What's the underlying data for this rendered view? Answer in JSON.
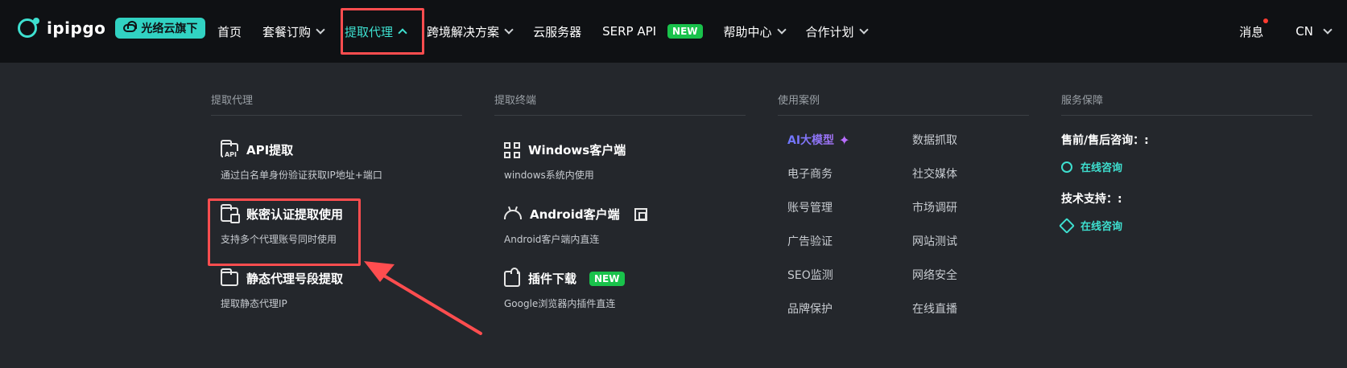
{
  "brand": {
    "logo_text": "ipipgo",
    "badge_text": "光络云旗下"
  },
  "nav": {
    "items": [
      {
        "label": "首页",
        "has_dropdown": false,
        "active": false
      },
      {
        "label": "套餐订购",
        "has_dropdown": true,
        "active": false
      },
      {
        "label": "提取代理",
        "has_dropdown": true,
        "active": true
      },
      {
        "label": "跨境解决方案",
        "has_dropdown": true,
        "active": false
      },
      {
        "label": "云服务器",
        "has_dropdown": false,
        "active": false
      },
      {
        "label": "SERP API",
        "has_dropdown": false,
        "active": false,
        "badge": "NEW"
      },
      {
        "label": "帮助中心",
        "has_dropdown": true,
        "active": false
      },
      {
        "label": "合作计划",
        "has_dropdown": true,
        "active": false
      }
    ],
    "messages_label": "消息",
    "language_label": "CN"
  },
  "menu": {
    "col1": {
      "title": "提取代理",
      "items": [
        {
          "title": "API提取",
          "desc": "通过白名单身份验证获取IP地址+端口",
          "icon": "folder-api-icon"
        },
        {
          "title": "账密认证提取使用",
          "desc": "支持多个代理账号同时使用",
          "icon": "folder-lock-icon"
        },
        {
          "title": "静态代理号段提取",
          "desc": "提取静态代理IP",
          "icon": "folder-static-icon"
        }
      ]
    },
    "col2": {
      "title": "提取终端",
      "items": [
        {
          "title": "Windows客户端",
          "desc": "windows系统内使用",
          "icon": "windows-icon"
        },
        {
          "title": "Android客户端",
          "desc": "Android客户端内直连",
          "icon": "android-icon",
          "extra_icon": "qr-icon"
        },
        {
          "title": "插件下载",
          "desc": "Google浏览器内插件直连",
          "icon": "plugin-icon",
          "badge": "NEW"
        }
      ]
    },
    "col3": {
      "title": "使用案例",
      "links": [
        "AI大模型",
        "数据抓取",
        "电子商务",
        "社交媒体",
        "账号管理",
        "市场调研",
        "广告验证",
        "网站测试",
        "SEO监测",
        "网络安全",
        "品牌保护",
        "在线直播"
      ]
    },
    "col4": {
      "title": "服务保障",
      "presales_label": "售前/售后咨询：:",
      "presales_link": "在线咨询",
      "tech_label": "技术支持：:",
      "tech_link": "在线咨询"
    }
  },
  "colors": {
    "accent": "#3ee0d0",
    "highlight": "#ff4d4f",
    "new_badge": "#19c24b"
  }
}
